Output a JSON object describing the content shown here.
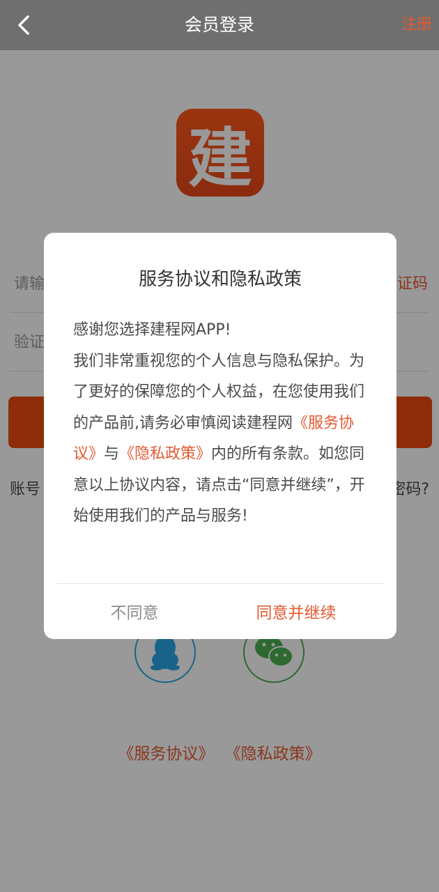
{
  "header": {
    "title": "会员登录",
    "register_label": "注册"
  },
  "logo": {
    "text": "建"
  },
  "form": {
    "phone_placeholder": "请输",
    "get_code_label": "证码",
    "code_placeholder": "验证"
  },
  "bottom_links": {
    "left": "账号",
    "right": "密码?"
  },
  "social": {
    "qq_icon": "qq-icon",
    "wechat_icon": "wechat-icon"
  },
  "agreement_links": {
    "service": "《服务协议》",
    "privacy": "《隐私政策》"
  },
  "dialog": {
    "title": "服务协议和隐私政策",
    "line1": "感谢您选择建程网APP!",
    "line2": "我们非常重视您的个人信息与隐私保护。为了更好的保障您的个人权益，在您使用我们的产品前,请务必审慎阅读建程网",
    "service_link": "《服务协议》",
    "and": "与",
    "privacy_link": "《隐私政策》",
    "line3": "内的所有条款。如您同意以上协议内容，请点击“同意并继续”，开始使用我们的产品与服务!",
    "disagree_label": "不同意",
    "agree_label": "同意并继续"
  },
  "colors": {
    "accent": "#e35a32",
    "header_bg": "#6f6f6f",
    "button": "#ef4a10"
  }
}
